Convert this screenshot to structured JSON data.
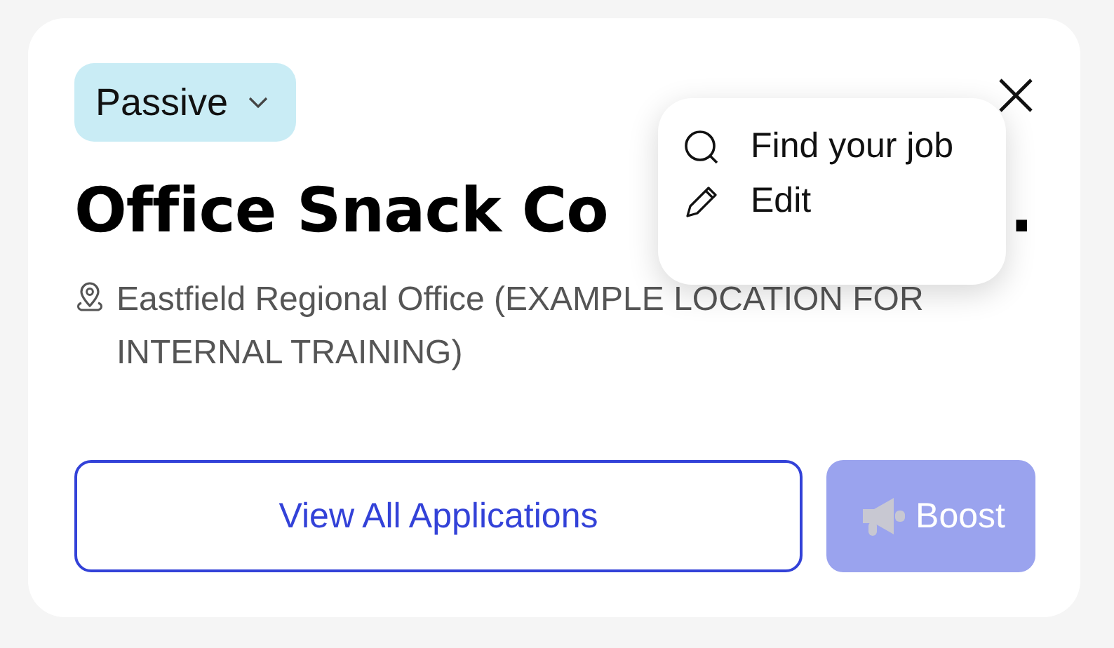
{
  "status_chip": {
    "label": "Passive"
  },
  "title": "Office Snack Co",
  "title_tail": ".",
  "location": "Eastfield Regional Office (EXAMPLE LOCATION FOR INTERNAL TRAINING)",
  "menu": {
    "open": true,
    "items": [
      {
        "kind": "search",
        "label": "Find your job"
      },
      {
        "kind": "edit",
        "label": "Edit"
      }
    ]
  },
  "buttons": [
    {
      "kind": "outline",
      "label": "View All Applications",
      "disabled": false
    },
    {
      "kind": "boost",
      "label": "Boost",
      "disabled": true
    }
  ]
}
